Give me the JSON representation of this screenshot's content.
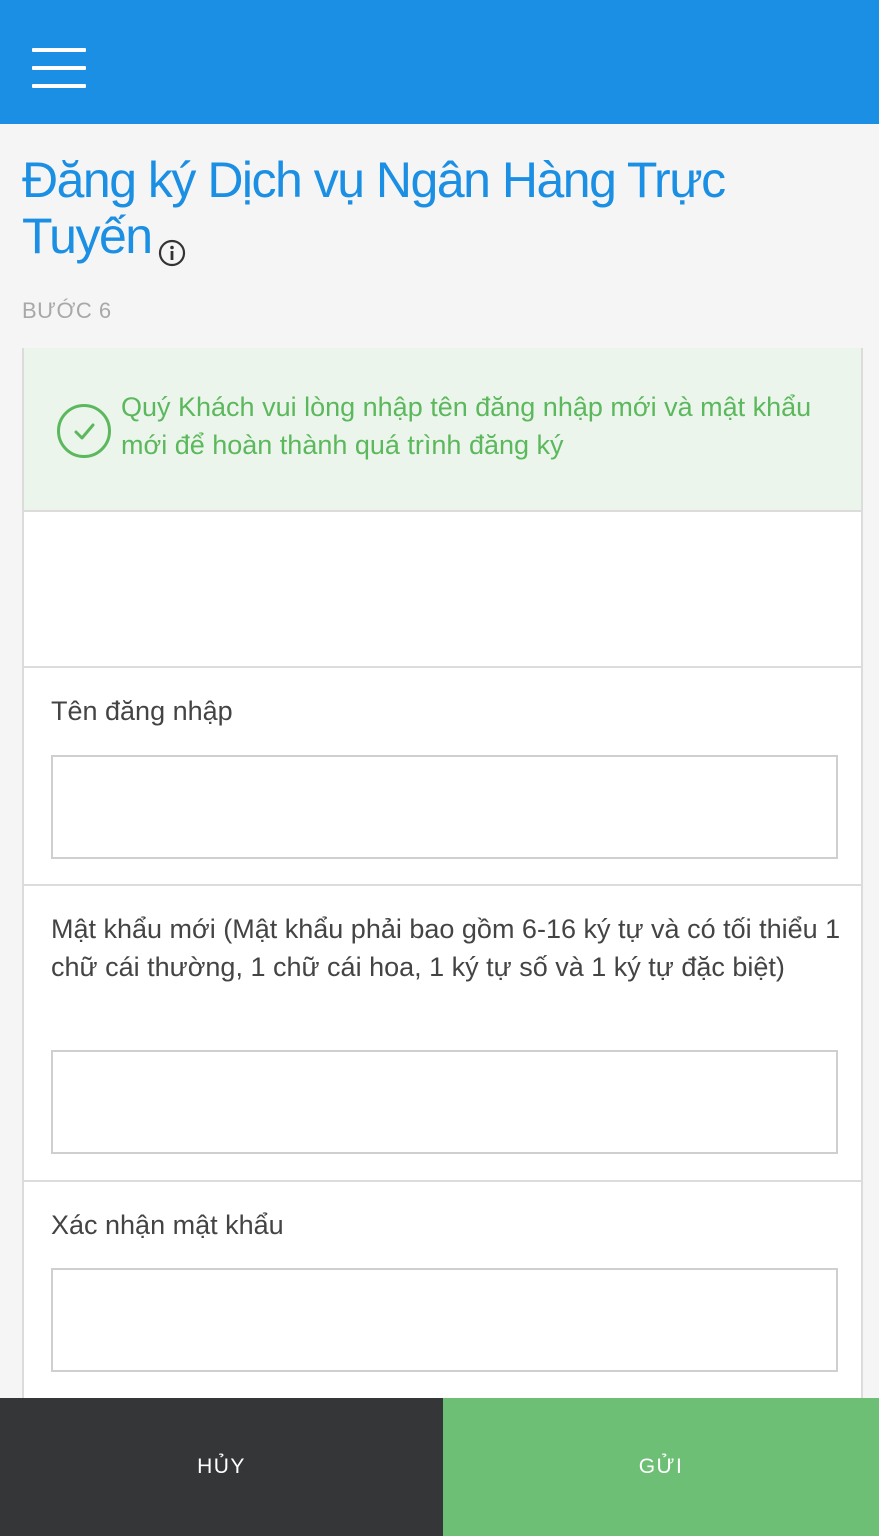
{
  "header": {
    "menu_icon": "hamburger-menu-icon",
    "color": "#1b8fe3"
  },
  "page": {
    "title": "Đăng ký Dịch vụ Ngân Hàng Trực Tuyến",
    "info_icon": "info-circle-icon",
    "step": "BƯỚC 6"
  },
  "notice": {
    "icon": "check-circle-icon",
    "text": "Quý Khách vui lòng nhập tên đăng nhập mới và mật khẩu mới để hoàn thành quá trình đăng ký",
    "color": "#5cb85c",
    "background": "#ebf5ec"
  },
  "form": {
    "username_label": "Tên đăng nhập",
    "username_value": "",
    "new_password_label": "Mật khẩu mới (Mật khẩu phải bao gồm 6-16 ký tự và có tối thiểu 1 chữ cái thường, 1 chữ cái hoa, 1 ký tự số và 1 ký tự đặc biệt)",
    "new_password_value": "",
    "confirm_password_label": "Xác nhận mật khẩu",
    "confirm_password_value": ""
  },
  "footer": {
    "cancel_label": "HỦY",
    "submit_label": "GỬI",
    "cancel_color": "#353638",
    "submit_color": "#6cbf74"
  }
}
